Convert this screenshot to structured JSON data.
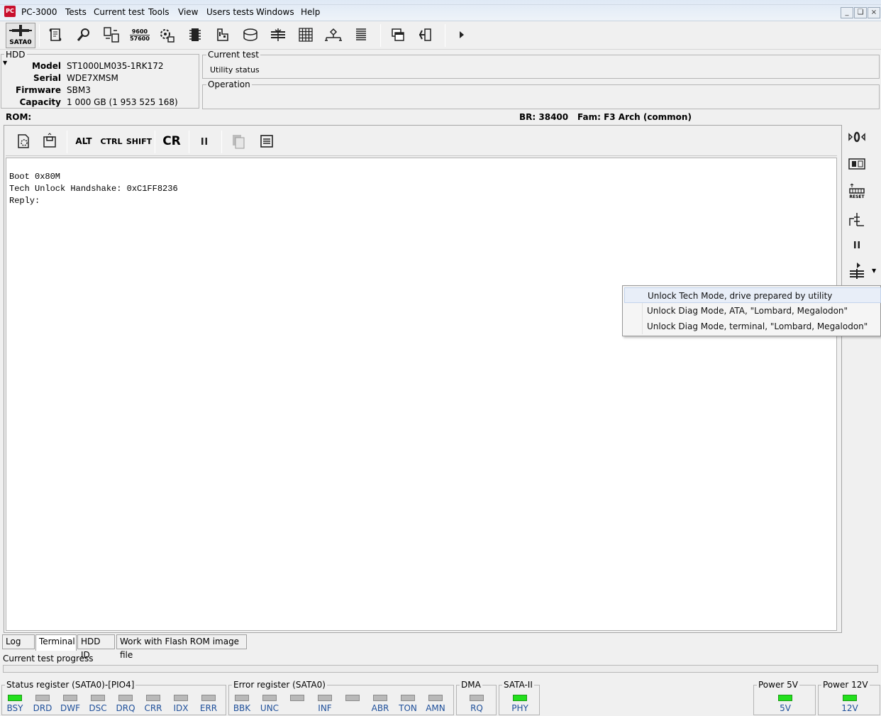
{
  "app": {
    "title": "PC-3000",
    "menu": [
      "Tests",
      "Current test",
      "Tools",
      "View",
      "Users tests",
      "Windows",
      "Help"
    ],
    "window_controls": [
      "_",
      "❏",
      "×"
    ]
  },
  "toolbar": {
    "sata_label": "SATA0",
    "baud_top": "9600",
    "baud_bottom": "57600"
  },
  "hdd": {
    "title": "HDD",
    "model_label": "Model",
    "model": "ST1000LM035-1RK172",
    "serial_label": "Serial",
    "serial": "WDE7XMSM",
    "firmware_label": "Firmware",
    "firmware": "SBM3",
    "capacity_label": "Capacity",
    "capacity": "1 000 GB (1 953 525 168)"
  },
  "current_test": {
    "title": "Current test",
    "value": "Utility status"
  },
  "operation": {
    "title": "Operation"
  },
  "rom_bar": {
    "rom": "ROM:",
    "br": "BR: 38400",
    "fam": "Fam: F3 Arch (common)"
  },
  "terminal_toolbar": {
    "alt": "ALT",
    "ctrl": "CTRL",
    "shift": "SHIFT",
    "cr": "CR"
  },
  "terminal": {
    "lines": "Boot 0x80M\nTech Unlock Handshake: 0xC1FF8236\nReply:"
  },
  "side_strip": {
    "reset_label": "RESET"
  },
  "context_menu": {
    "items": [
      "Unlock Tech Mode, drive prepared by utility",
      "Unlock Diag Mode, ATA, \"Lombard, Megalodon\"",
      "Unlock Diag Mode, terminal, \"Lombard, Megalodon\""
    ]
  },
  "tabs": [
    "Log",
    "Terminal",
    "HDD ID",
    "Work with Flash ROM image file"
  ],
  "progress": {
    "label": "Current test progress",
    "value": 0
  },
  "status_register": {
    "title": "Status register (SATA0)-[PIO4]",
    "leds": [
      {
        "label": "BSY",
        "on": true
      },
      {
        "label": "DRD",
        "on": false
      },
      {
        "label": "DWF",
        "on": false
      },
      {
        "label": "DSC",
        "on": false
      },
      {
        "label": "DRQ",
        "on": false
      },
      {
        "label": "CRR",
        "on": false
      },
      {
        "label": "IDX",
        "on": false
      },
      {
        "label": "ERR",
        "on": false
      }
    ]
  },
  "error_register": {
    "title": "Error register (SATA0)",
    "leds": [
      {
        "label": "BBK",
        "on": false
      },
      {
        "label": "UNC",
        "on": false
      },
      {
        "label": "",
        "on": false
      },
      {
        "label": "INF",
        "on": false
      },
      {
        "label": "",
        "on": false
      },
      {
        "label": "ABR",
        "on": false
      },
      {
        "label": "TON",
        "on": false
      },
      {
        "label": "AMN",
        "on": false
      }
    ]
  },
  "dma": {
    "title": "DMA",
    "label": "RQ",
    "on": false
  },
  "sata": {
    "title": "SATA-II",
    "label": "PHY",
    "on": true
  },
  "power5": {
    "title": "Power 5V",
    "label": "5V",
    "on": true
  },
  "power12": {
    "title": "Power 12V",
    "label": "12V",
    "on": true
  },
  "colors": {
    "led_on": "#23e01d",
    "led_off": "#b9b9b9",
    "led_label": "#1e4f9a",
    "app_icon": "#c8102e"
  }
}
